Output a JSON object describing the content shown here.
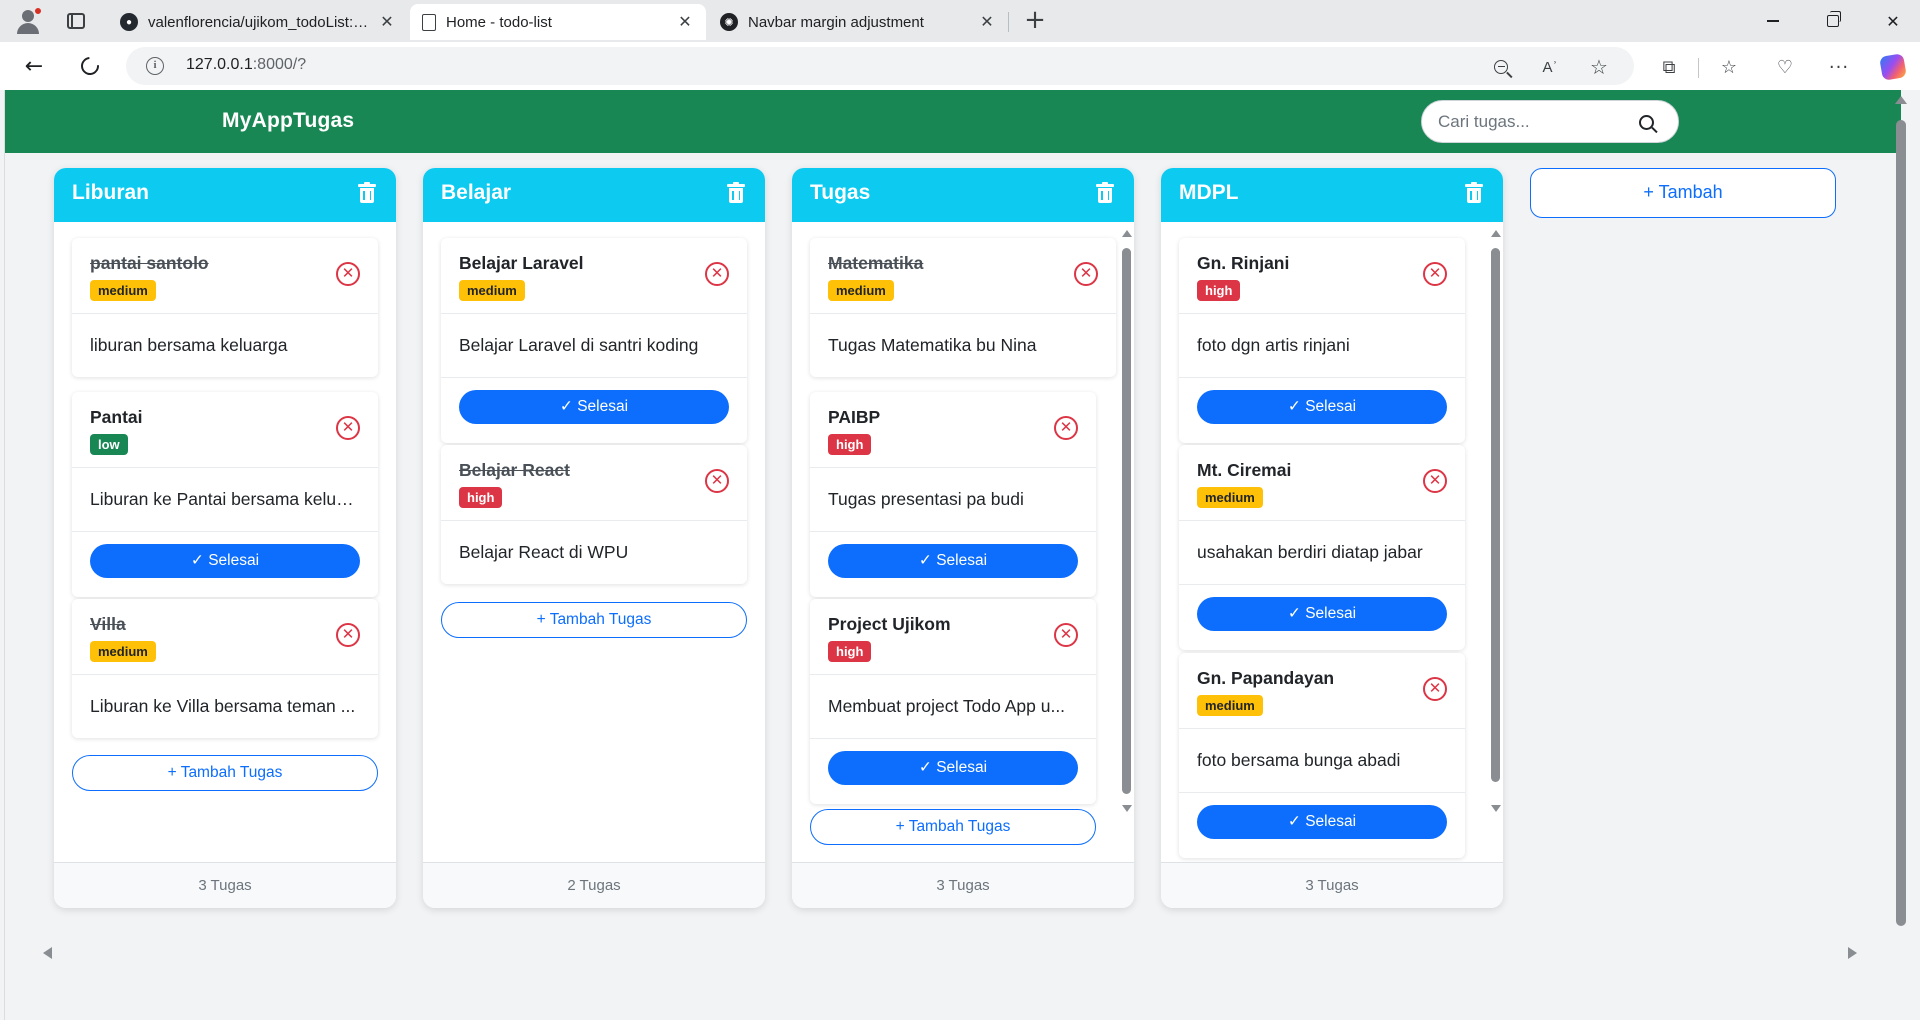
{
  "browser": {
    "tabs": [
      {
        "label": "valenflorencia/ujikom_todoList: pr",
        "icon": "github-icon",
        "close": "✕"
      },
      {
        "label": "Home - todo-list",
        "icon": "page-icon",
        "close": "✕"
      },
      {
        "label": "Navbar margin adjustment",
        "icon": "chatgpt-icon",
        "close": "✕"
      }
    ],
    "new_tab": "+",
    "url_host": "127.0.0.1",
    "url_path": ":8000/?",
    "read_aloud": "Aʾ",
    "more": "···"
  },
  "navbar": {
    "brand": "MyAppTugas",
    "search_placeholder": "Cari tugas...",
    "color": "#198754"
  },
  "theme": {
    "header_color": "#0dcaf0",
    "primary": "#0d6efd",
    "danger": "#dc3545",
    "warning": "#ffc107",
    "success": "#198754"
  },
  "board": {
    "add_column_label": "+  Tambah",
    "done_label": "✓ Selesai",
    "add_task_label": "+  Tambah Tugas",
    "delete_icon": "✕",
    "columns": [
      {
        "title": "Liburan",
        "footer": "3 Tugas",
        "tasks": [
          {
            "name": "pantai santolo",
            "priority": "medium",
            "description": "liburan bersama keluarga",
            "done": true
          },
          {
            "name": "Pantai",
            "priority": "low",
            "description": "Liburan ke Pantai bersama kelua...",
            "done": false
          },
          {
            "name": "Villa",
            "priority": "medium",
            "description": "Liburan ke Villa bersama teman ...",
            "done": true
          }
        ]
      },
      {
        "title": "Belajar",
        "footer": "2 Tugas",
        "tasks": [
          {
            "name": "Belajar Laravel",
            "priority": "medium",
            "description": "Belajar Laravel di santri koding",
            "done": false
          },
          {
            "name": "Belajar React",
            "priority": "high",
            "description": "Belajar React di WPU",
            "done": true
          }
        ]
      },
      {
        "title": "Tugas",
        "footer": "3 Tugas",
        "tasks": [
          {
            "name": "Matematika",
            "priority": "medium",
            "description": "Tugas Matematika bu Nina",
            "done": true
          },
          {
            "name": "PAIBP",
            "priority": "high",
            "description": "Tugas presentasi pa budi",
            "done": false
          },
          {
            "name": "Project Ujikom",
            "priority": "high",
            "description": "Membuat project Todo App u...",
            "done": false
          }
        ]
      },
      {
        "title": "MDPL",
        "footer": "3 Tugas",
        "tasks": [
          {
            "name": "Gn. Rinjani",
            "priority": "high",
            "description": "foto dgn artis rinjani",
            "done": false
          },
          {
            "name": "Mt. Ciremai",
            "priority": "medium",
            "description": "usahakan berdiri diatap jabar",
            "done": false
          },
          {
            "name": "Gn. Papandayan",
            "priority": "medium",
            "description": "foto bersama bunga abadi",
            "done": false
          }
        ]
      }
    ]
  }
}
